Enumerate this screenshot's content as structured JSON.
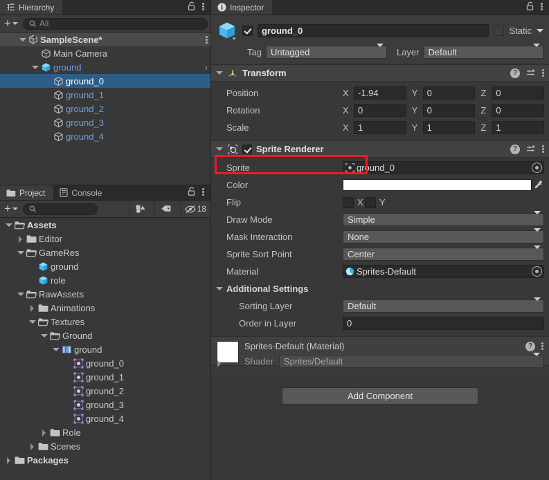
{
  "hierarchy": {
    "tab_label": "Hierarchy",
    "tab_icon": "hierarchy-icon",
    "lock_icon": "lock-icon",
    "menu_icon": "kebab-menu-icon",
    "create_label": "+",
    "search_placeholder": "All",
    "search_value": "",
    "rows": [
      {
        "label": "SampleScene*",
        "depth": 1,
        "expander": "down",
        "icon": "unity-scene-icon",
        "style": "bold",
        "selected": false,
        "scene": true,
        "menu": true
      },
      {
        "label": "Main Camera",
        "depth": 2,
        "expander": "none",
        "icon": "gameobject-cube-icon",
        "style": "normal",
        "selected": false
      },
      {
        "label": "ground",
        "depth": 2,
        "expander": "down",
        "icon": "prefab-cube-icon",
        "style": "prefab",
        "selected": false,
        "chevron": "›"
      },
      {
        "label": "ground_0",
        "depth": 3,
        "expander": "none",
        "icon": "gameobject-cube-icon",
        "style": "white",
        "selected": true
      },
      {
        "label": "ground_1",
        "depth": 3,
        "expander": "none",
        "icon": "gameobject-cube-icon",
        "style": "prefab",
        "selected": false
      },
      {
        "label": "ground_2",
        "depth": 3,
        "expander": "none",
        "icon": "gameobject-cube-icon",
        "style": "prefab",
        "selected": false
      },
      {
        "label": "ground_3",
        "depth": 3,
        "expander": "none",
        "icon": "gameobject-cube-icon",
        "style": "prefab",
        "selected": false
      },
      {
        "label": "ground_4",
        "depth": 3,
        "expander": "none",
        "icon": "gameobject-cube-icon",
        "style": "prefab",
        "selected": false
      }
    ]
  },
  "project": {
    "tab_label": "Project",
    "tab_icon": "folder-icon",
    "console_tab_label": "Console",
    "console_tab_icon": "console-icon",
    "lock_icon": "lock-icon",
    "menu_icon": "kebab-menu-icon",
    "create_label": "+",
    "search_placeholder": "",
    "search_value": "",
    "filter_type_icon": "filter-by-type-icon",
    "filter_label_icon": "filter-by-label-icon",
    "hidden_count": "18",
    "hidden_icon": "eye-off-icon",
    "rows": [
      {
        "label": "Assets",
        "depth": 0,
        "expander": "down",
        "icon": "folder-open-icon",
        "style": "bold"
      },
      {
        "label": "Editor",
        "depth": 1,
        "expander": "right",
        "icon": "folder-icon",
        "style": "normal"
      },
      {
        "label": "GameRes",
        "depth": 1,
        "expander": "down",
        "icon": "folder-open-icon",
        "style": "normal"
      },
      {
        "label": "ground",
        "depth": 2,
        "expander": "none",
        "icon": "prefab-cube-icon",
        "style": "normal"
      },
      {
        "label": "role",
        "depth": 2,
        "expander": "none",
        "icon": "prefab-cube-icon",
        "style": "normal"
      },
      {
        "label": "RawAssets",
        "depth": 1,
        "expander": "down",
        "icon": "folder-open-icon",
        "style": "normal"
      },
      {
        "label": "Animations",
        "depth": 2,
        "expander": "right",
        "icon": "folder-icon",
        "style": "normal"
      },
      {
        "label": "Textures",
        "depth": 2,
        "expander": "down",
        "icon": "folder-open-icon",
        "style": "normal"
      },
      {
        "label": "Ground",
        "depth": 3,
        "expander": "down",
        "icon": "folder-open-icon",
        "style": "normal"
      },
      {
        "label": "ground",
        "depth": 4,
        "expander": "down",
        "icon": "texture-icon",
        "style": "normal"
      },
      {
        "label": "ground_0",
        "depth": 5,
        "expander": "none",
        "icon": "sprite-icon",
        "style": "normal"
      },
      {
        "label": "ground_1",
        "depth": 5,
        "expander": "none",
        "icon": "sprite-icon",
        "style": "normal"
      },
      {
        "label": "ground_2",
        "depth": 5,
        "expander": "none",
        "icon": "sprite-icon",
        "style": "normal"
      },
      {
        "label": "ground_3",
        "depth": 5,
        "expander": "none",
        "icon": "sprite-icon",
        "style": "normal"
      },
      {
        "label": "ground_4",
        "depth": 5,
        "expander": "none",
        "icon": "sprite-icon",
        "style": "normal"
      },
      {
        "label": "Role",
        "depth": 3,
        "expander": "right",
        "icon": "folder-icon",
        "style": "normal"
      },
      {
        "label": "Scenes",
        "depth": 2,
        "expander": "right",
        "icon": "folder-icon",
        "style": "normal"
      },
      {
        "label": "Packages",
        "depth": 0,
        "expander": "right",
        "icon": "folder-icon",
        "style": "bold"
      }
    ]
  },
  "inspector": {
    "tab_label": "Inspector",
    "tab_icon": "info-icon",
    "lock_icon": "lock-icon",
    "menu_icon": "kebab-menu-icon",
    "gameobject": {
      "icon": "prefab-cube-icon",
      "enabled": true,
      "name": "ground_0",
      "static_label": "Static",
      "static_checked": false,
      "tag_label": "Tag",
      "tag_value": "Untagged",
      "layer_label": "Layer",
      "layer_value": "Default"
    },
    "transform": {
      "title": "Transform",
      "icon": "transform-axis-icon",
      "expanded": true,
      "help_icon": "help-icon",
      "preset_icon": "preset-icon",
      "menu_icon": "kebab-menu-icon",
      "rows": [
        {
          "label": "Position",
          "x": "-1.94",
          "y": "0",
          "z": "0"
        },
        {
          "label": "Rotation",
          "x": "0",
          "y": "0",
          "z": "0"
        },
        {
          "label": "Scale",
          "x": "1",
          "y": "1",
          "z": "1"
        }
      ],
      "axis_labels": [
        "X",
        "Y",
        "Z"
      ]
    },
    "sprite_renderer": {
      "title": "Sprite Renderer",
      "icon": "sprite-renderer-icon",
      "enabled": true,
      "expanded": true,
      "highlighted": true,
      "highlight_color": "#f01a20",
      "help_icon": "help-icon",
      "preset_icon": "preset-icon",
      "menu_icon": "kebab-menu-icon",
      "sprite_label": "Sprite",
      "sprite_value": "ground_0",
      "sprite_icon": "sprite-icon",
      "color_label": "Color",
      "color_value": "#ffffff",
      "eyedropper_icon": "eyedropper-icon",
      "flip_label": "Flip",
      "flip_x_label": "X",
      "flip_y_label": "Y",
      "flip_x": false,
      "flip_y": false,
      "draw_mode_label": "Draw Mode",
      "draw_mode_value": "Simple",
      "mask_interaction_label": "Mask Interaction",
      "mask_interaction_value": "None",
      "sprite_sort_point_label": "Sprite Sort Point",
      "sprite_sort_point_value": "Center",
      "material_label": "Material",
      "material_value": "Sprites-Default",
      "material_icon": "material-sphere-icon",
      "additional_settings_label": "Additional Settings",
      "sorting_layer_label": "Sorting Layer",
      "sorting_layer_value": "Default",
      "order_in_layer_label": "Order in Layer",
      "order_in_layer_value": "0"
    },
    "material_preview": {
      "title": "Sprites-Default (Material)",
      "swatch_color": "#ffffff",
      "shader_label": "Shader",
      "shader_value": "Sprites/Default",
      "help_icon": "help-icon",
      "menu_icon": "kebab-menu-icon"
    },
    "add_component_label": "Add Component"
  }
}
